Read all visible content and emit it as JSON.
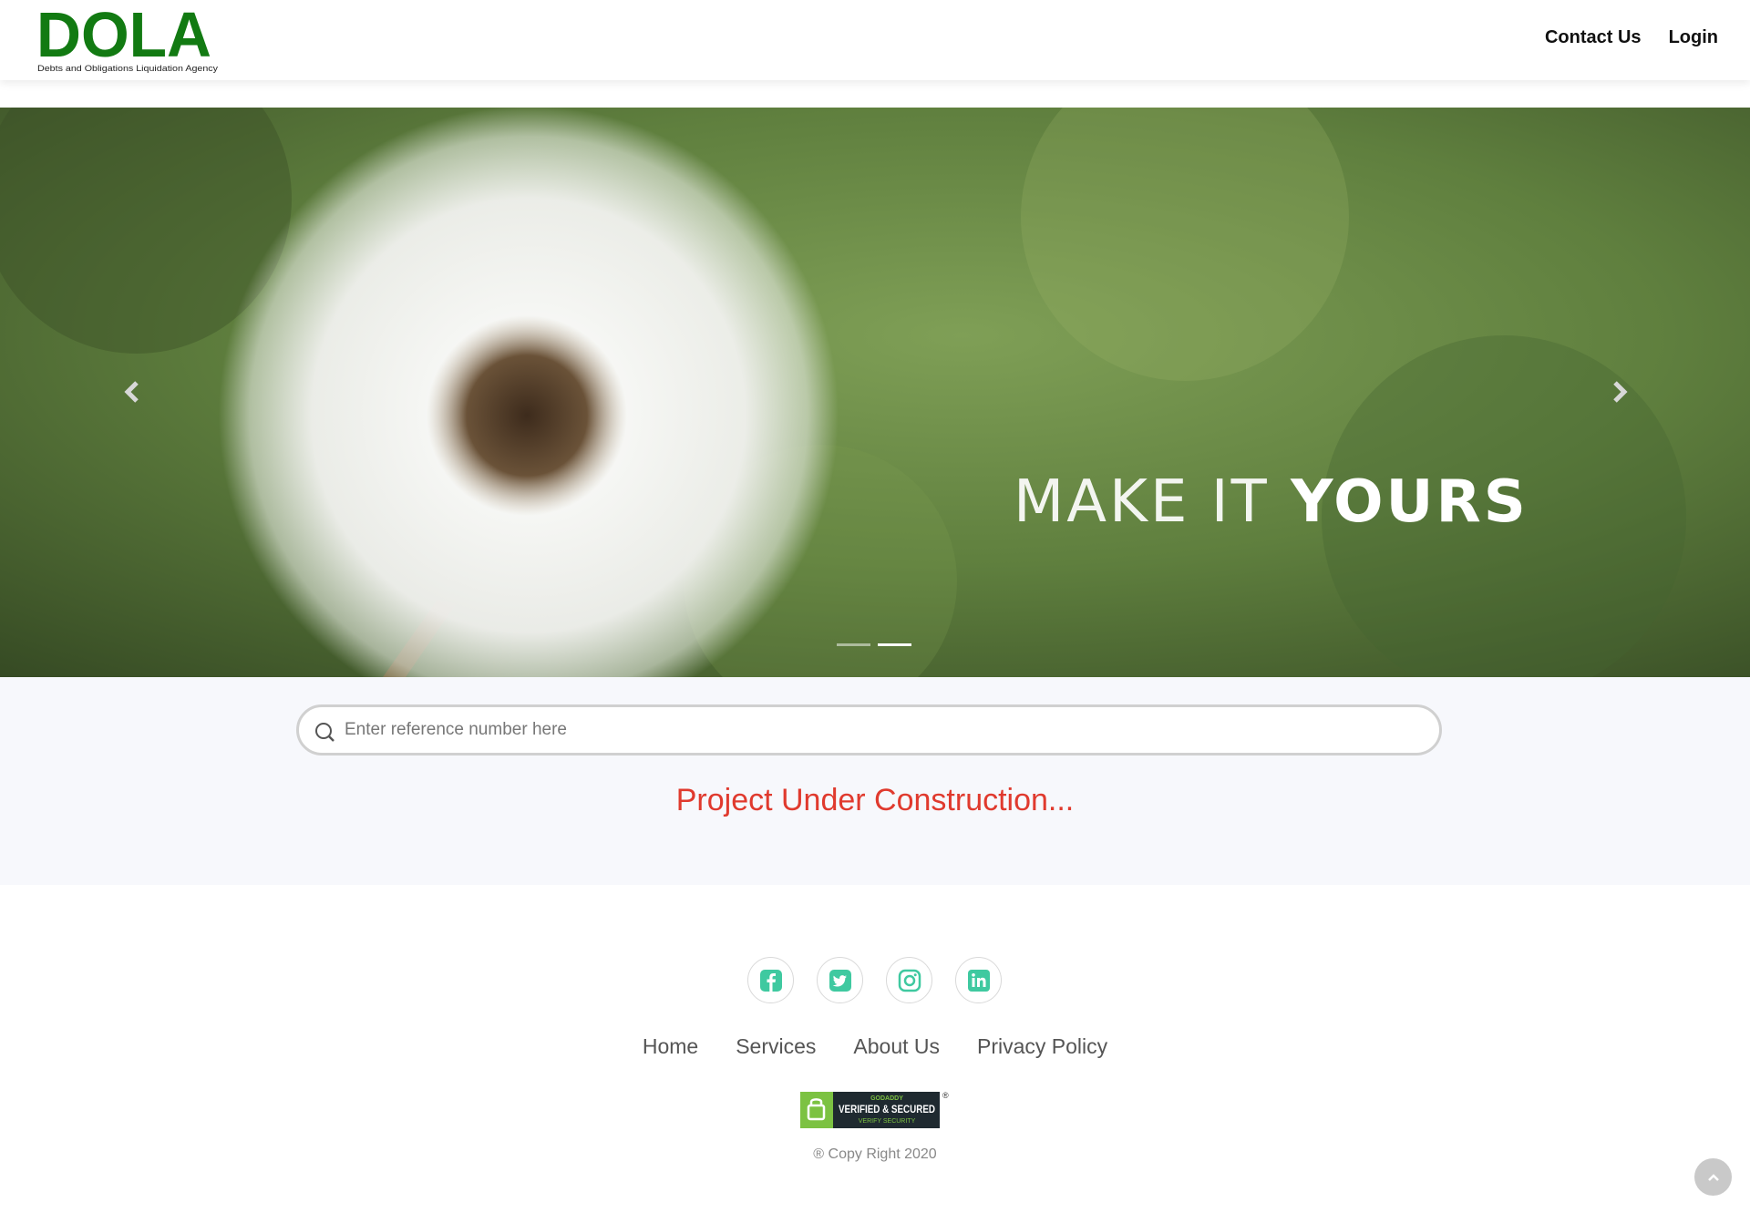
{
  "header": {
    "logo_text": "DOLA",
    "logo_subtitle": "Debts and Obligations Liquidation Agency",
    "nav": [
      {
        "label": "Contact Us"
      },
      {
        "label": "Login"
      }
    ]
  },
  "hero": {
    "tagline_thin": "MAKE IT",
    "tagline_bold": "YOURS",
    "slide_count": 2,
    "active_slide": 2
  },
  "search": {
    "placeholder": "Enter reference number here"
  },
  "status_message": "Project Under Construction...",
  "footer": {
    "socials": [
      {
        "icon": "facebook-icon"
      },
      {
        "icon": "twitter-icon"
      },
      {
        "icon": "instagram-icon"
      },
      {
        "icon": "linkedin-icon"
      }
    ],
    "links": [
      {
        "label": "Home"
      },
      {
        "label": "Services"
      },
      {
        "label": "About Us"
      },
      {
        "label": "Privacy Policy"
      }
    ],
    "seal": {
      "top": "GODADDY",
      "main": "VERIFIED & SECURED",
      "bottom": "VERIFY SECURITY"
    },
    "copyright": "® Copy Right 2020"
  },
  "colors": {
    "brand_green": "#127a12",
    "social_green": "#3fc9a0",
    "status_red": "#e03a2e"
  }
}
